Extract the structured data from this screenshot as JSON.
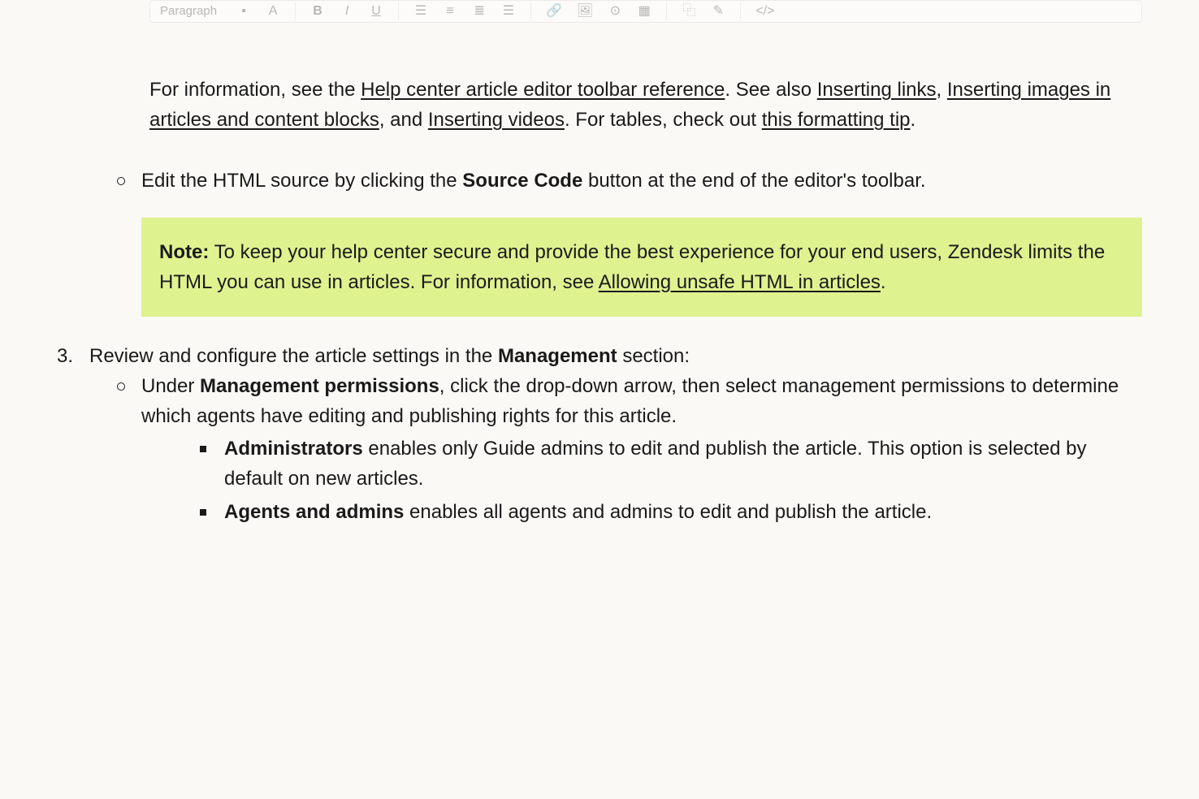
{
  "toolbar": {
    "paragraph_label": "Paragraph"
  },
  "intro": {
    "p1_pre": "For information, see the ",
    "p1_link1": "Help center article editor toolbar reference",
    "p1_mid1": ". See also ",
    "p1_link2": "Inserting links",
    "p1_mid2": ", ",
    "p1_link3": "Inserting images in articles and content blocks",
    "p1_mid3": ", and ",
    "p1_link4": "Inserting videos",
    "p1_mid4": ". For tables, check out ",
    "p1_link5": "this formatting tip",
    "p1_end": "."
  },
  "bullet_source": {
    "pre": "Edit the HTML source by clicking the ",
    "bold": "Source Code",
    "post": " button at the end of the editor's toolbar."
  },
  "note": {
    "label": "Note:",
    "text_pre": " To keep your help center secure and provide the best experience for your end users, Zendesk limits the HTML you can use in articles. For information, see ",
    "link": "Allowing unsafe HTML in articles",
    "text_post": "."
  },
  "step3": {
    "number": "3.",
    "text_pre": "Review and configure the article settings in the ",
    "bold": "Management",
    "text_post": " section:"
  },
  "mgmt_perm": {
    "pre": "Under ",
    "bold": "Management permissions",
    "post": ", click the drop-down arrow, then select management permissions to determine which agents have editing and publishing rights for this article."
  },
  "role_admin": {
    "bold": "Administrators",
    "text": " enables only Guide admins to edit and publish the article. This option is selected by default on new articles."
  },
  "role_agents": {
    "bold": "Agents and admins",
    "text": " enables all agents and admins to edit and publish the article."
  }
}
